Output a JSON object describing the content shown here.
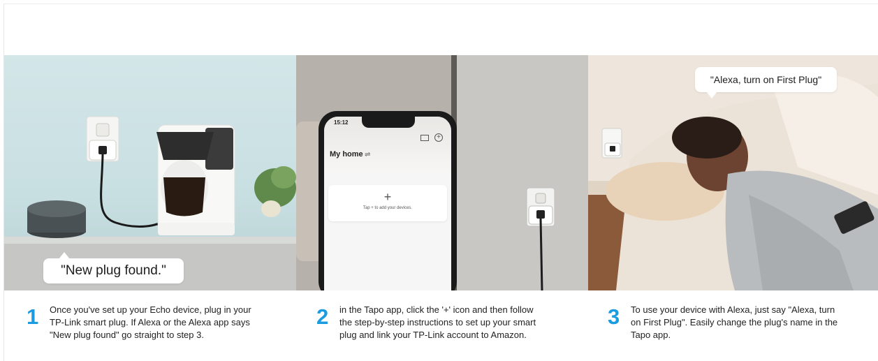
{
  "steps": [
    {
      "number": "1",
      "lines": [
        "Once you've set up your Echo device, plug in your",
        "TP-Link smart plug. If Alexa or the Alexa app says",
        "\"New plug found\" go straight to step 3."
      ]
    },
    {
      "number": "2",
      "lines": [
        "in the Tapo app, click the '+' icon and then follow",
        "the step-by-step instructions to set up your smart",
        "plug and link your TP-Link account to Amazon."
      ]
    },
    {
      "number": "3",
      "lines": [
        "To use your device with Alexa, just say \"Alexa, turn",
        "on First Plug\". Easily change the plug's name in the",
        "Tapo app."
      ]
    }
  ],
  "panel1": {
    "bubble_text": "\"New plug found.\""
  },
  "panel2": {
    "phone_time": "15:12",
    "home_title": "My home",
    "add_symbol": "+",
    "add_hint": "Tap + to add your devices."
  },
  "panel3": {
    "bubble_text": "\"Alexa, turn on First Plug\""
  },
  "colors": {
    "accent": "#1b9ce0"
  }
}
